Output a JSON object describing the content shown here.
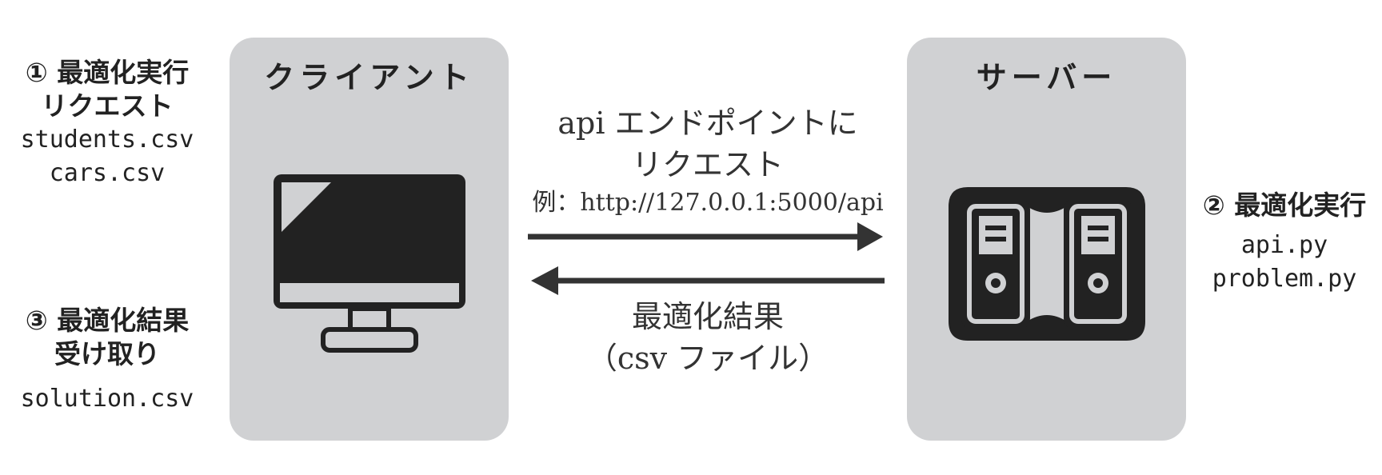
{
  "client": {
    "title": "クライアント",
    "icon": "monitor-icon"
  },
  "server": {
    "title": "サーバー",
    "icon": "server-icon"
  },
  "step1": {
    "title": "① 最適化実行",
    "subtitle": "リクエスト",
    "files": [
      "students.csv",
      "cars.csv"
    ]
  },
  "step2": {
    "title": "② 最適化実行",
    "files": [
      "api.py",
      "problem.py"
    ]
  },
  "step3": {
    "title": "③ 最適化結果",
    "subtitle": "受け取り",
    "files": [
      "solution.csv"
    ]
  },
  "request": {
    "line1": "api エンドポイントに",
    "line2": "リクエスト",
    "example": "例：http://127.0.0.1:5000/api"
  },
  "result": {
    "line1": "最適化結果",
    "line2": "（csv ファイル）"
  },
  "colors": {
    "panel": "#d0d1d3",
    "icon": "#222222",
    "arrow": "#333333"
  }
}
